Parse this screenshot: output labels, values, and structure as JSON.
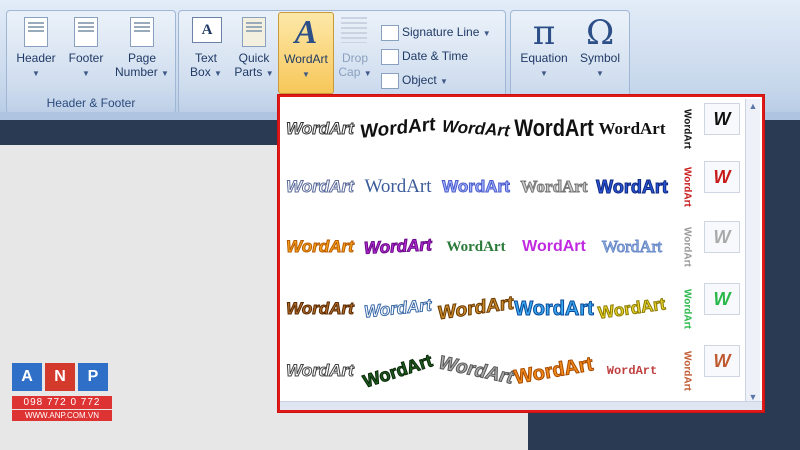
{
  "ribbon": {
    "header_footer_group": {
      "label": "Header & Footer",
      "header": "Header",
      "footer": "Footer",
      "page_number_line1": "Page",
      "page_number_line2": "Number"
    },
    "text_group": {
      "text_box_line1": "Text",
      "text_box_line2": "Box",
      "quick_parts_line1": "Quick",
      "quick_parts_line2": "Parts",
      "wordart": "WordArt",
      "drop_cap_line1": "Drop",
      "drop_cap_line2": "Cap",
      "signature_line": "Signature Line",
      "date_time": "Date & Time",
      "object": "Object"
    },
    "symbols_group": {
      "equation": "Equation",
      "symbol": "Symbol",
      "pi_glyph": "π",
      "omega_glyph": "Ω"
    }
  },
  "gallery": {
    "style_text": "WordArt",
    "vertical_text": "WordArt",
    "letter_w": "W",
    "styles_count": 30
  },
  "logo": {
    "letters": [
      "A",
      "N",
      "P"
    ],
    "colors": [
      "#2f6fc7",
      "#d33a2c",
      "#2f6fc7"
    ],
    "phone": "098 772 0 772",
    "website": "WWW.ANP.COM.VN"
  }
}
